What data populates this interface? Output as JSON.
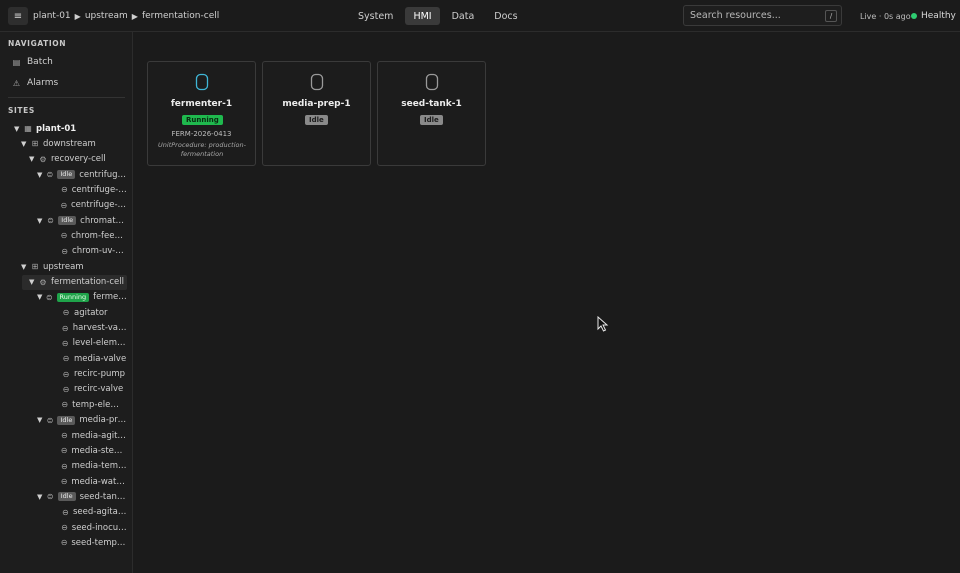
{
  "header": {
    "menu_icon": "hamburger-icon",
    "breadcrumb": [
      "plant-01",
      "upstream",
      "fermentation-cell"
    ],
    "breadcrumb_sep": "▶",
    "tabs": [
      {
        "label": "System",
        "active": false
      },
      {
        "label": "HMI",
        "active": true
      },
      {
        "label": "Data",
        "active": false
      },
      {
        "label": "Docs",
        "active": false
      }
    ],
    "search_placeholder": "Search resources...",
    "search_shortcut": "/",
    "live_status": "Live · 0s ago",
    "health_label": "Healthy",
    "health_color": "#2ecc71"
  },
  "sidebar": {
    "navigation_title": "NAVIGATION",
    "nav_items": [
      {
        "label": "Batch",
        "icon": "clipboard-icon"
      },
      {
        "label": "Alarms",
        "icon": "warning-icon"
      }
    ],
    "sites_title": "SITES",
    "tree": [
      {
        "label": "plant-01",
        "icon": "building-icon",
        "bold": true,
        "caret": "▼"
      },
      {
        "label": "downstream",
        "icon": "grid-icon",
        "caret": "▼"
      },
      {
        "label": "recovery-cell",
        "icon": "cell-icon",
        "caret": "▼"
      },
      {
        "label": "centrifuge-1",
        "icon": "unit-icon",
        "caret": "▼",
        "badge": "Idle"
      },
      {
        "label": "centrifuge-di...",
        "icon": "equipment-icon"
      },
      {
        "label": "centrifuge-dri...",
        "icon": "equipment-icon"
      },
      {
        "label": "chromato...",
        "icon": "unit-icon",
        "caret": "▼",
        "badge": "Idle"
      },
      {
        "label": "chrom-feed-p...",
        "icon": "equipment-icon"
      },
      {
        "label": "chrom-uv-se...",
        "icon": "equipment-icon"
      },
      {
        "label": "upstream",
        "icon": "grid-icon",
        "caret": "▼"
      },
      {
        "label": "fermentation-cell",
        "icon": "cell-icon",
        "caret": "▼",
        "selected": true
      },
      {
        "label": "fermen...",
        "icon": "unit-icon",
        "caret": "▼",
        "badge": "Running"
      },
      {
        "label": "agitator",
        "icon": "equipment-icon"
      },
      {
        "label": "harvest-valve",
        "icon": "equipment-icon"
      },
      {
        "label": "level-element",
        "icon": "equipment-icon"
      },
      {
        "label": "media-valve",
        "icon": "equipment-icon"
      },
      {
        "label": "recirc-pump",
        "icon": "equipment-icon"
      },
      {
        "label": "recirc-valve",
        "icon": "equipment-icon"
      },
      {
        "label": "temp-element",
        "icon": "equipment-icon"
      },
      {
        "label": "media-pre...",
        "icon": "unit-icon",
        "caret": "▼",
        "badge": "Idle"
      },
      {
        "label": "media-agitator",
        "icon": "equipment-icon"
      },
      {
        "label": "media-steam...",
        "icon": "equipment-icon"
      },
      {
        "label": "media-temp-...",
        "icon": "equipment-icon"
      },
      {
        "label": "media-water-...",
        "icon": "equipment-icon"
      },
      {
        "label": "seed-tank-1",
        "icon": "unit-icon",
        "caret": "▼",
        "badge": "Idle"
      },
      {
        "label": "seed-agitator",
        "icon": "equipment-icon"
      },
      {
        "label": "seed-inoculu...",
        "icon": "equipment-icon"
      },
      {
        "label": "seed-temp-el...",
        "icon": "equipment-icon"
      }
    ]
  },
  "cards": [
    {
      "name": "fermenter-1",
      "state": "Running",
      "batch": "FERM-2026-0413",
      "procedure": "UnitProcedure: production-fermentation",
      "icon_color": "#3fb6d6",
      "icon": "tank-icon"
    },
    {
      "name": "media-prep-1",
      "state": "Idle",
      "icon_color": "#9a9a9a",
      "icon": "tank-icon"
    },
    {
      "name": "seed-tank-1",
      "state": "Idle",
      "icon_color": "#9a9a9a",
      "icon": "tank-icon"
    }
  ]
}
